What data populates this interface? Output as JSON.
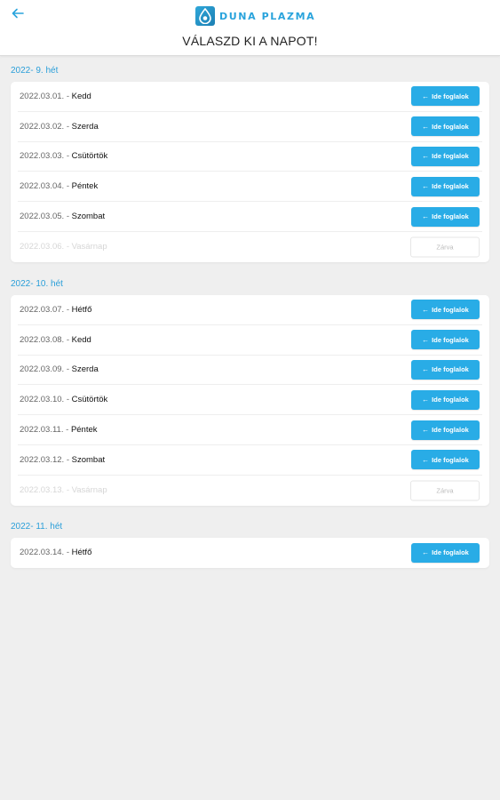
{
  "header": {
    "logo_text": "DUNA PLAZMA",
    "title": "VÁLASZD KI A NAPOT!",
    "back_icon": "arrow-left-icon",
    "accent_color": "#29ace6"
  },
  "book_label": "Ide foglalok",
  "closed_label": "Zárva",
  "weeks": [
    {
      "label": "2022- 9. hét",
      "days": [
        {
          "date": "2022.03.01. - ",
          "day": "Kedd",
          "open": true
        },
        {
          "date": "2022.03.02. - ",
          "day": "Szerda",
          "open": true
        },
        {
          "date": "2022.03.03. - ",
          "day": "Csütörtök",
          "open": true
        },
        {
          "date": "2022.03.04. - ",
          "day": "Péntek",
          "open": true
        },
        {
          "date": "2022.03.05. - ",
          "day": "Szombat",
          "open": true
        },
        {
          "date": "2022.03.06. - ",
          "day": "Vasárnap",
          "open": false
        }
      ]
    },
    {
      "label": "2022- 10. hét",
      "days": [
        {
          "date": "2022.03.07. - ",
          "day": "Hétfő",
          "open": true
        },
        {
          "date": "2022.03.08. - ",
          "day": "Kedd",
          "open": true
        },
        {
          "date": "2022.03.09. - ",
          "day": "Szerda",
          "open": true
        },
        {
          "date": "2022.03.10. - ",
          "day": "Csütörtök",
          "open": true
        },
        {
          "date": "2022.03.11. - ",
          "day": "Péntek",
          "open": true
        },
        {
          "date": "2022.03.12. - ",
          "day": "Szombat",
          "open": true
        },
        {
          "date": "2022.03.13. - ",
          "day": "Vasárnap",
          "open": false
        }
      ]
    },
    {
      "label": "2022- 11. hét",
      "days": [
        {
          "date": "2022.03.14. - ",
          "day": "Hétfő",
          "open": true
        }
      ]
    }
  ]
}
